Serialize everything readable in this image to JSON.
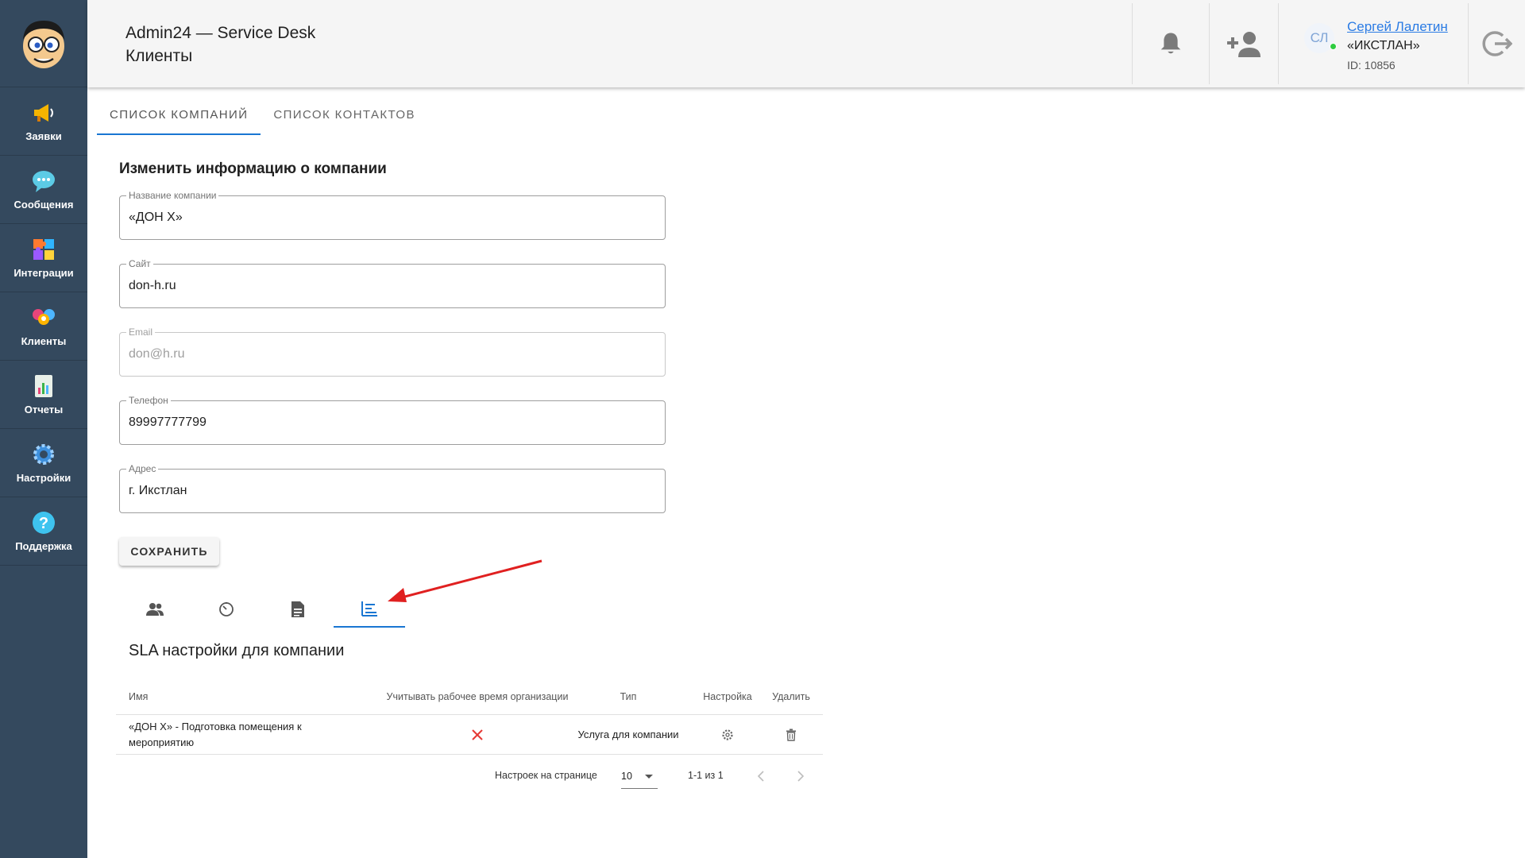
{
  "sidebar": {
    "logo_icon": "cartoon-face-logo",
    "items": [
      {
        "label": "Заявки",
        "icon": "megaphone-icon"
      },
      {
        "label": "Сообщения",
        "icon": "chat-bubble-icon"
      },
      {
        "label": "Интеграции",
        "icon": "puzzle-icon"
      },
      {
        "label": "Клиенты",
        "icon": "people-icon"
      },
      {
        "label": "Отчеты",
        "icon": "report-chart-icon"
      },
      {
        "label": "Настройки",
        "icon": "gear-icon"
      },
      {
        "label": "Поддержка",
        "icon": "question-icon"
      }
    ],
    "colors": {
      "background": "#34495e"
    }
  },
  "header": {
    "title": "Admin24 — Service Desk",
    "subtitle": "Клиенты",
    "user": {
      "initials": "СЛ",
      "name": "Сергей Лалетин",
      "org": "«ИКСТЛАН»",
      "id": "ID: 10856"
    }
  },
  "tabs": [
    "СПИСОК КОМПАНИЙ",
    "СПИСОК КОНТАКТОВ"
  ],
  "form": {
    "title": "Изменить информацию о компании",
    "fields": [
      {
        "label": "Название компании",
        "value": "«ДОН Х»"
      },
      {
        "label": "Сайт",
        "value": "don-h.ru"
      },
      {
        "label": "Email",
        "value": "don@h.ru"
      },
      {
        "label": "Телефон",
        "value": "89997777799"
      },
      {
        "label": "Адрес",
        "value": "г. Икстлан"
      }
    ],
    "save_label": "СОХРАНИТЬ"
  },
  "icon_tabs": [
    "contacts-icon",
    "timer-icon",
    "document-icon",
    "sla-list-icon"
  ],
  "sla": {
    "title": "SLA настройки для компании",
    "columns": [
      "Имя",
      "Учитывать рабочее время организации",
      "Тип",
      "Настройка",
      "Удалить"
    ],
    "rows": [
      {
        "name": "«ДОН Х» - Подготовка помещения к мероприятию",
        "work_time": "no",
        "type": "Услуга для компании"
      }
    ],
    "pager": {
      "per_page_label": "Настроек на странице",
      "per_page": "10",
      "range": "1-1 из 1"
    }
  },
  "colors": {
    "accent": "#1976d2",
    "link": "#2a7be4",
    "danger": "#e53935",
    "arrow": "#e02020"
  }
}
